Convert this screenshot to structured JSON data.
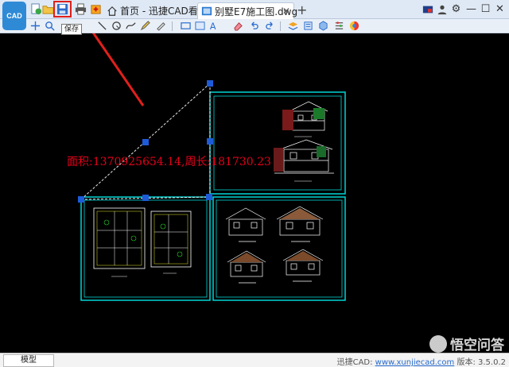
{
  "app": {
    "logo_text": "CAD"
  },
  "tabs": [
    {
      "label": "首页 - 迅捷CAD看图"
    },
    {
      "label": "别墅E7施工图.dwg"
    }
  ],
  "tooltip": {
    "text": "保存"
  },
  "canvas": {
    "measurement_text": "面积:1370925654.14,周长:181730.23",
    "line_color": "#00d6d6",
    "annotation_color": "#e3001b",
    "selection_color": "#1e5bd8"
  },
  "statusbar": {
    "model_tab": "模型",
    "version_prefix": "迅捷CAD: ",
    "version_url": "www.xunjiecad.com",
    "version_suffix": " 版本: 3.5.0.2"
  },
  "watermark": {
    "text": "悟空问答"
  }
}
